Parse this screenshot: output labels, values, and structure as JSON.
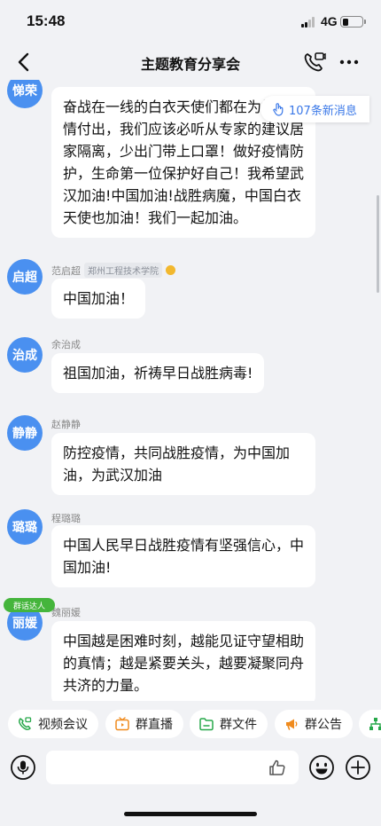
{
  "status_bar": {
    "time": "15:48",
    "network": "4G",
    "battery_level": 0.3
  },
  "nav": {
    "title": "主题教育分享会"
  },
  "new_messages": {
    "label": "107条新消息"
  },
  "messages": [
    {
      "avatar": "悌荣",
      "sender": "",
      "org": "",
      "text": "奋战在一线的白衣天使们都在为抗击疫情付出，我们应该必听从专家的建议居家隔离，少出门带上口罩！做好疫情防护，生命第一位保护好自己！我希望武汉加油!中国加油!战胜病魔，中国白衣天使也加油！我们一起加油。"
    },
    {
      "avatar": "启超",
      "sender": "范启超",
      "org": "郑州工程技术学院",
      "text": "中国加油！"
    },
    {
      "avatar": "治成",
      "sender": "余治成",
      "org": "",
      "text": "祖国加油，祈祷早日战胜病毒!"
    },
    {
      "avatar": "静静",
      "sender": "赵静静",
      "org": "",
      "text": "防控疫情，共同战胜疫情，为中国加油，为武汉加油"
    },
    {
      "avatar": "璐璐",
      "sender": "程璐璐",
      "org": "",
      "text": "中国人民早日战胜疫情有坚强信心，中国加油!"
    },
    {
      "avatar": "丽媛",
      "sender": "魏丽媛",
      "org": "",
      "badge": "群话达人",
      "text": "中国越是困难时刻，越能见证守望相助的真情；越是紧要关头，越要凝聚同舟共济的力量。"
    }
  ],
  "quick_actions": [
    {
      "label": "视频会议",
      "icon": "video-call-icon",
      "color": "#27a84a"
    },
    {
      "label": "群直播",
      "icon": "live-tv-icon",
      "color": "#f08a1c"
    },
    {
      "label": "群文件",
      "icon": "folder-icon",
      "color": "#27a84a"
    },
    {
      "label": "群公告",
      "icon": "megaphone-icon",
      "color": "#f08a1c"
    }
  ],
  "input": {
    "placeholder": ""
  }
}
